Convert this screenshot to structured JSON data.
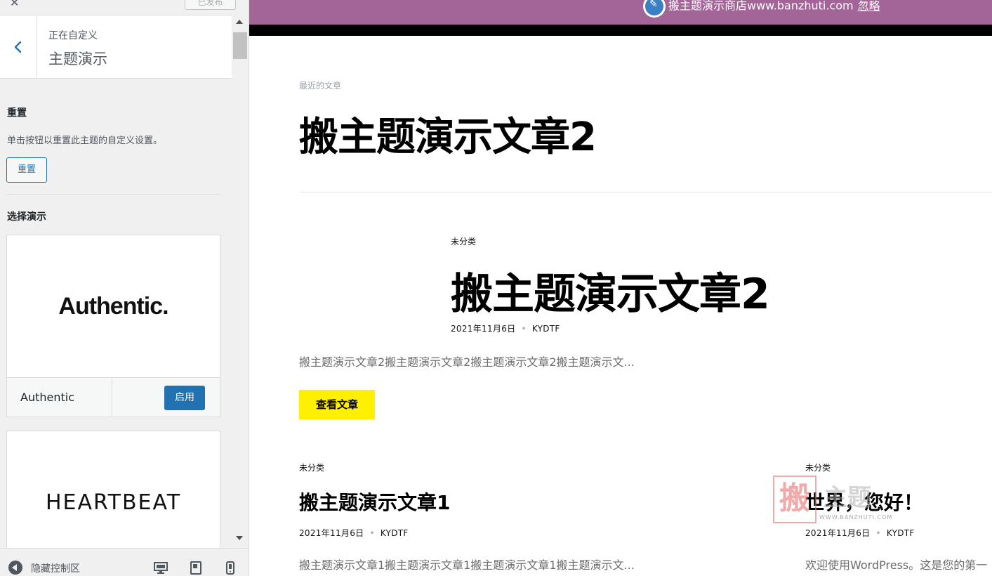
{
  "sidebar": {
    "close_glyph": "✕",
    "publish_label": "已发布",
    "pre_title": "正在自定义",
    "panel_title": "主题演示",
    "reset_section": {
      "title": "重置",
      "description": "单击按钮以重置此主题的自定义设置。",
      "button_label": "重置"
    },
    "demos_section": {
      "title": "选择演示",
      "demos": [
        {
          "logo_text": "Authentic.",
          "name": "Authentic",
          "action_label": "启用"
        },
        {
          "logo_text": "HEARTBEAT"
        }
      ]
    },
    "footer": {
      "collapse_label": "隐藏控制区"
    }
  },
  "preview": {
    "store_notice": "搬主题演示商店www.banzhuti.com",
    "dismiss_label": "忽略",
    "archive_label": "最近的文章",
    "archive_title": "搬主题演示文章2",
    "featured_post": {
      "category": "未分类",
      "title": "搬主题演示文章2",
      "date": "2021年11月6日",
      "author": "KYDTF",
      "excerpt": "搬主题演示文章2搬主题演示文章2搬主题演示文章2搬主题演示文...",
      "button_label": "查看文章"
    },
    "posts": [
      {
        "category": "未分类",
        "title": "搬主题演示文章1",
        "date": "2021年11月6日",
        "author": "KYDTF",
        "excerpt": "搬主题演示文章1搬主题演示文章1搬主题演示文章1搬主题演示文..."
      },
      {
        "category": "未分类",
        "title": "世界，您好！",
        "date": "2021年11月6日",
        "author": "KYDTF",
        "excerpt": "欢迎使用WordPress。这是您的第一"
      }
    ],
    "watermark": {
      "seal_char": "搬",
      "text": "主题",
      "url": "WWW.BANZHUTI.COM"
    }
  },
  "colors": {
    "wp_blue": "#2271b1",
    "demo_bar": "#a36597",
    "button_yellow": "#fff000"
  }
}
